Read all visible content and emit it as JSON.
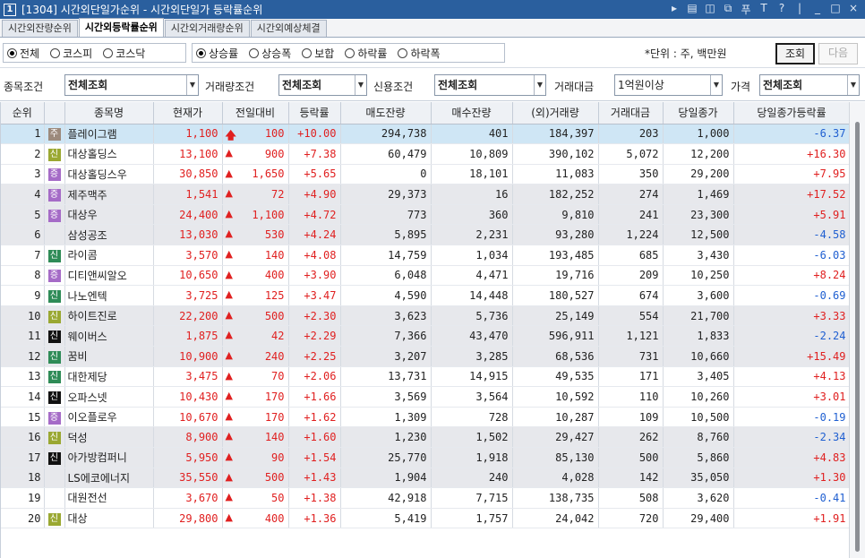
{
  "window": {
    "screen_no": "1",
    "title": "[1304] 시간외단일가순위 - 시간외단일가 등락률순위",
    "icons": [
      "▸",
      "▤",
      "◫",
      "⧉",
      "푸",
      "T",
      "?",
      "|",
      "_",
      "□",
      "×"
    ]
  },
  "tabs": [
    {
      "label": "시간외잔량순위",
      "active": false
    },
    {
      "label": "시간외등락률순위",
      "active": true
    },
    {
      "label": "시간외거래량순위",
      "active": false
    },
    {
      "label": "시간외예상체결",
      "active": false
    }
  ],
  "market_radios": [
    {
      "label": "전체",
      "checked": true
    },
    {
      "label": "코스피",
      "checked": false
    },
    {
      "label": "코스닥",
      "checked": false
    }
  ],
  "sort_radios": [
    {
      "label": "상승률",
      "checked": true
    },
    {
      "label": "상승폭",
      "checked": false
    },
    {
      "label": "보합",
      "checked": false
    },
    {
      "label": "하락률",
      "checked": false
    },
    {
      "label": "하락폭",
      "checked": false
    }
  ],
  "unit_text": "*단위 : 주, 백만원",
  "buttons": {
    "search": "조회",
    "next": "다음"
  },
  "filters": [
    {
      "label": "종목조건",
      "value": "전체조회"
    },
    {
      "label": "거래량조건",
      "value": "전체조회"
    },
    {
      "label": "신용조건",
      "value": "전체조회"
    },
    {
      "label": "거래대금",
      "value": "1억원이상"
    },
    {
      "label": "가격",
      "value": "전체조회"
    }
  ],
  "columns": [
    "순위",
    "",
    "종목명",
    "현재가",
    "전일대비",
    "등락률",
    "매도잔량",
    "매수잔량",
    "(외)거래량",
    "거래대금",
    "당일종가",
    "당일종가등락률"
  ],
  "rows": [
    {
      "rank": "1",
      "badge": "주",
      "badge_type": "trade",
      "name": "플레이그램",
      "price": "1,100",
      "arrow": "🡅",
      "diff": "100",
      "rate": "+10.00",
      "ask": "294,738",
      "bid": "401",
      "vol": "184,397",
      "amt": "203",
      "close": "1,000",
      "close_rate": "-6.37",
      "group": "hi"
    },
    {
      "rank": "2",
      "badge": "신",
      "badge_type": "sin-y",
      "name": "대상홀딩스",
      "price": "13,100",
      "arrow": "▲",
      "diff": "900",
      "rate": "+7.38",
      "ask": "60,479",
      "bid": "10,809",
      "vol": "390,102",
      "amt": "5,072",
      "close": "12,200",
      "close_rate": "+16.30",
      "group": ""
    },
    {
      "rank": "3",
      "badge": "증",
      "badge_type": "jung",
      "name": "대상홀딩스우",
      "price": "30,850",
      "arrow": "▲",
      "diff": "1,650",
      "rate": "+5.65",
      "ask": "0",
      "bid": "18,101",
      "vol": "11,083",
      "amt": "350",
      "close": "29,200",
      "close_rate": "+7.95",
      "group": ""
    },
    {
      "rank": "4",
      "badge": "증",
      "badge_type": "jung",
      "name": "제주맥주",
      "price": "1,541",
      "arrow": "▲",
      "diff": "72",
      "rate": "+4.90",
      "ask": "29,373",
      "bid": "16",
      "vol": "182,252",
      "amt": "274",
      "close": "1,469",
      "close_rate": "+17.52",
      "group": "g"
    },
    {
      "rank": "5",
      "badge": "증",
      "badge_type": "jung",
      "name": "대상우",
      "price": "24,400",
      "arrow": "▲",
      "diff": "1,100",
      "rate": "+4.72",
      "ask": "773",
      "bid": "360",
      "vol": "9,810",
      "amt": "241",
      "close": "23,300",
      "close_rate": "+5.91",
      "group": "g"
    },
    {
      "rank": "6",
      "badge": "",
      "badge_type": "",
      "name": "삼성공조",
      "price": "13,030",
      "arrow": "▲",
      "diff": "530",
      "rate": "+4.24",
      "ask": "5,895",
      "bid": "2,231",
      "vol": "93,280",
      "amt": "1,224",
      "close": "12,500",
      "close_rate": "-4.58",
      "group": "g"
    },
    {
      "rank": "7",
      "badge": "신",
      "badge_type": "sin",
      "name": "라이콤",
      "price": "3,570",
      "arrow": "▲",
      "diff": "140",
      "rate": "+4.08",
      "ask": "14,759",
      "bid": "1,034",
      "vol": "193,485",
      "amt": "685",
      "close": "3,430",
      "close_rate": "-6.03",
      "group": ""
    },
    {
      "rank": "8",
      "badge": "증",
      "badge_type": "jung",
      "name": "디티앤씨알오",
      "price": "10,650",
      "arrow": "▲",
      "diff": "400",
      "rate": "+3.90",
      "ask": "6,048",
      "bid": "4,471",
      "vol": "19,716",
      "amt": "209",
      "close": "10,250",
      "close_rate": "+8.24",
      "group": ""
    },
    {
      "rank": "9",
      "badge": "신",
      "badge_type": "sin",
      "name": "나노엔텍",
      "price": "3,725",
      "arrow": "▲",
      "diff": "125",
      "rate": "+3.47",
      "ask": "4,590",
      "bid": "14,448",
      "vol": "180,527",
      "amt": "674",
      "close": "3,600",
      "close_rate": "-0.69",
      "group": ""
    },
    {
      "rank": "10",
      "badge": "신",
      "badge_type": "sin-y",
      "name": "하이트진로",
      "price": "22,200",
      "arrow": "▲",
      "diff": "500",
      "rate": "+2.30",
      "ask": "3,623",
      "bid": "5,736",
      "vol": "25,149",
      "amt": "554",
      "close": "21,700",
      "close_rate": "+3.33",
      "group": "g"
    },
    {
      "rank": "11",
      "badge": "신",
      "badge_type": "sin-k",
      "name": "웨이버스",
      "price": "1,875",
      "arrow": "▲",
      "diff": "42",
      "rate": "+2.29",
      "ask": "7,366",
      "bid": "43,470",
      "vol": "596,911",
      "amt": "1,121",
      "close": "1,833",
      "close_rate": "-2.24",
      "group": "g"
    },
    {
      "rank": "12",
      "badge": "신",
      "badge_type": "sin",
      "name": "꿈비",
      "price": "10,900",
      "arrow": "▲",
      "diff": "240",
      "rate": "+2.25",
      "ask": "3,207",
      "bid": "3,285",
      "vol": "68,536",
      "amt": "731",
      "close": "10,660",
      "close_rate": "+15.49",
      "group": "g"
    },
    {
      "rank": "13",
      "badge": "신",
      "badge_type": "sin",
      "name": "대한제당",
      "price": "3,475",
      "arrow": "▲",
      "diff": "70",
      "rate": "+2.06",
      "ask": "13,731",
      "bid": "14,915",
      "vol": "49,535",
      "amt": "171",
      "close": "3,405",
      "close_rate": "+4.13",
      "group": ""
    },
    {
      "rank": "14",
      "badge": "신",
      "badge_type": "sin-k",
      "name": "오파스넷",
      "price": "10,430",
      "arrow": "▲",
      "diff": "170",
      "rate": "+1.66",
      "ask": "3,569",
      "bid": "3,564",
      "vol": "10,592",
      "amt": "110",
      "close": "10,260",
      "close_rate": "+3.01",
      "group": ""
    },
    {
      "rank": "15",
      "badge": "증",
      "badge_type": "jung",
      "name": "이오플로우",
      "price": "10,670",
      "arrow": "▲",
      "diff": "170",
      "rate": "+1.62",
      "ask": "1,309",
      "bid": "728",
      "vol": "10,287",
      "amt": "109",
      "close": "10,500",
      "close_rate": "-0.19",
      "group": ""
    },
    {
      "rank": "16",
      "badge": "신",
      "badge_type": "sin-y",
      "name": "덕성",
      "price": "8,900",
      "arrow": "▲",
      "diff": "140",
      "rate": "+1.60",
      "ask": "1,230",
      "bid": "1,502",
      "vol": "29,427",
      "amt": "262",
      "close": "8,760",
      "close_rate": "-2.34",
      "group": "g"
    },
    {
      "rank": "17",
      "badge": "신",
      "badge_type": "sin-k",
      "name": "아가방컴퍼니",
      "price": "5,950",
      "arrow": "▲",
      "diff": "90",
      "rate": "+1.54",
      "ask": "25,770",
      "bid": "1,918",
      "vol": "85,130",
      "amt": "500",
      "close": "5,860",
      "close_rate": "+4.83",
      "group": "g"
    },
    {
      "rank": "18",
      "badge": "",
      "badge_type": "",
      "name": "LS에코에너지",
      "price": "35,550",
      "arrow": "▲",
      "diff": "500",
      "rate": "+1.43",
      "ask": "1,904",
      "bid": "240",
      "vol": "4,028",
      "amt": "142",
      "close": "35,050",
      "close_rate": "+1.30",
      "group": "g"
    },
    {
      "rank": "19",
      "badge": "",
      "badge_type": "",
      "name": "대원전선",
      "price": "3,670",
      "arrow": "▲",
      "diff": "50",
      "rate": "+1.38",
      "ask": "42,918",
      "bid": "7,715",
      "vol": "138,735",
      "amt": "508",
      "close": "3,620",
      "close_rate": "-0.41",
      "group": ""
    },
    {
      "rank": "20",
      "badge": "신",
      "badge_type": "sin-y",
      "name": "대상",
      "price": "29,800",
      "arrow": "▲",
      "diff": "400",
      "rate": "+1.36",
      "ask": "5,419",
      "bid": "1,757",
      "vol": "24,042",
      "amt": "720",
      "close": "29,400",
      "close_rate": "+1.91",
      "group": ""
    }
  ],
  "colors": {
    "title_bar": "#2a5f9e",
    "up": "#e02020",
    "down": "#1f5fd1",
    "highlight_row": "#cfe6f5"
  }
}
